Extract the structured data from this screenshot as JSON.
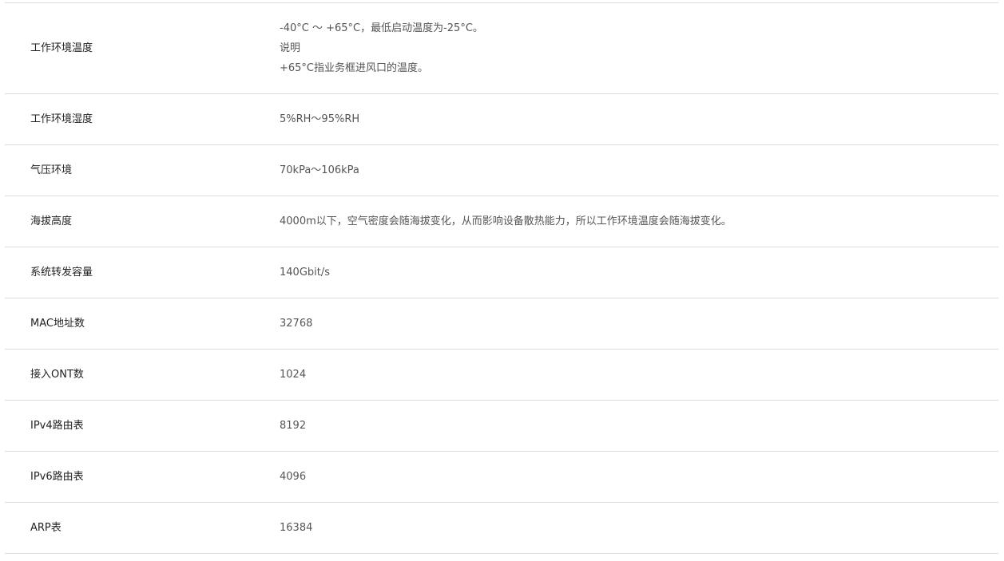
{
  "rows": [
    {
      "label": "工作环境温度",
      "lines": [
        " -40°C ～ +65°C，最低启动温度为-25°C。",
        "说明",
        "+65°C指业务框进风口的温度。"
      ]
    },
    {
      "label": "工作环境湿度",
      "value": "5%RH～95%RH"
    },
    {
      "label": "气压环境",
      "value": "70kPa～106kPa"
    },
    {
      "label": "海拔高度",
      "value": "4000m以下，空气密度会随海拔变化，从而影响设备散热能力，所以工作环境温度会随海拔变化。"
    },
    {
      "label": "系统转发容量",
      "value": "140Gbit/s"
    },
    {
      "label": "MAC地址数",
      "value": "32768"
    },
    {
      "label": "接入ONT数",
      "value": "1024"
    },
    {
      "label": "IPv4路由表",
      "value": "8192"
    },
    {
      "label": "IPv6路由表",
      "value": "4096"
    },
    {
      "label": "ARP表",
      "value": "16384"
    }
  ]
}
